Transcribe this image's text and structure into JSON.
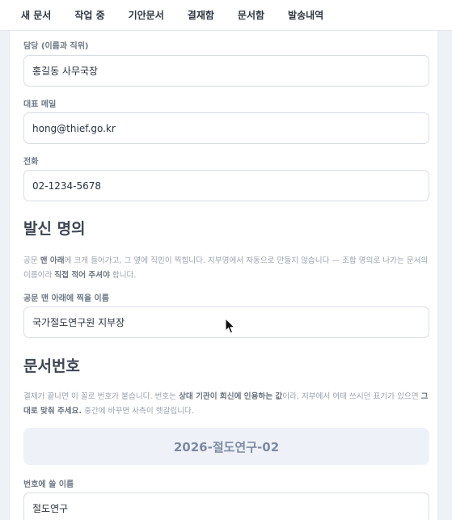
{
  "nav": {
    "tabs": [
      {
        "label": "새 문서"
      },
      {
        "label": "작업 중"
      },
      {
        "label": "기안문서"
      },
      {
        "label": "결재함"
      },
      {
        "label": "문서함"
      },
      {
        "label": "발송내역"
      }
    ]
  },
  "contact": {
    "manager_label": "담당 (이름과 직위)",
    "manager_value": "홍길동 사무국장",
    "email_label": "대표 메일",
    "email_value": "hong@thief.go.kr",
    "phone_label": "전화",
    "phone_value": "02-1234-5678"
  },
  "sender": {
    "heading": "발신 명의",
    "desc_part1": "공문 ",
    "desc_bold1": "맨 아래",
    "desc_part2": "에 크게 들어가고, 그 옆에 직인이 찍힙니다. 지부명에서 자동으로 만들지 않습니다 — 조합 명의로 나가는 문서의 이름이라 ",
    "desc_bold2": "직접 적어 주셔야",
    "desc_part3": " 합니다.",
    "name_label": "공문 맨 아래에 찍을 이름",
    "name_value": "국가절도연구원 지부장"
  },
  "docnum": {
    "heading": "문서번호",
    "desc_part1": "결재가 끝나면 이 꼴로 번호가 붙습니다. 번호는 ",
    "desc_bold1": "상대 기관이 회신에 인용하는 값",
    "desc_part2": "이라, 지부에서 여태 쓰시던 표기가 있으면 ",
    "desc_bold2": "그대로 맞춰 주세요.",
    "desc_part3": " 중간에 바꾸면 사측이 헷갈립니다.",
    "preview": "2026-절도연구-02",
    "prefix_label": "번호에 쓸 이름",
    "prefix_value": "절도연구"
  },
  "icons": {
    "cursor": "mouse-pointer-icon"
  }
}
